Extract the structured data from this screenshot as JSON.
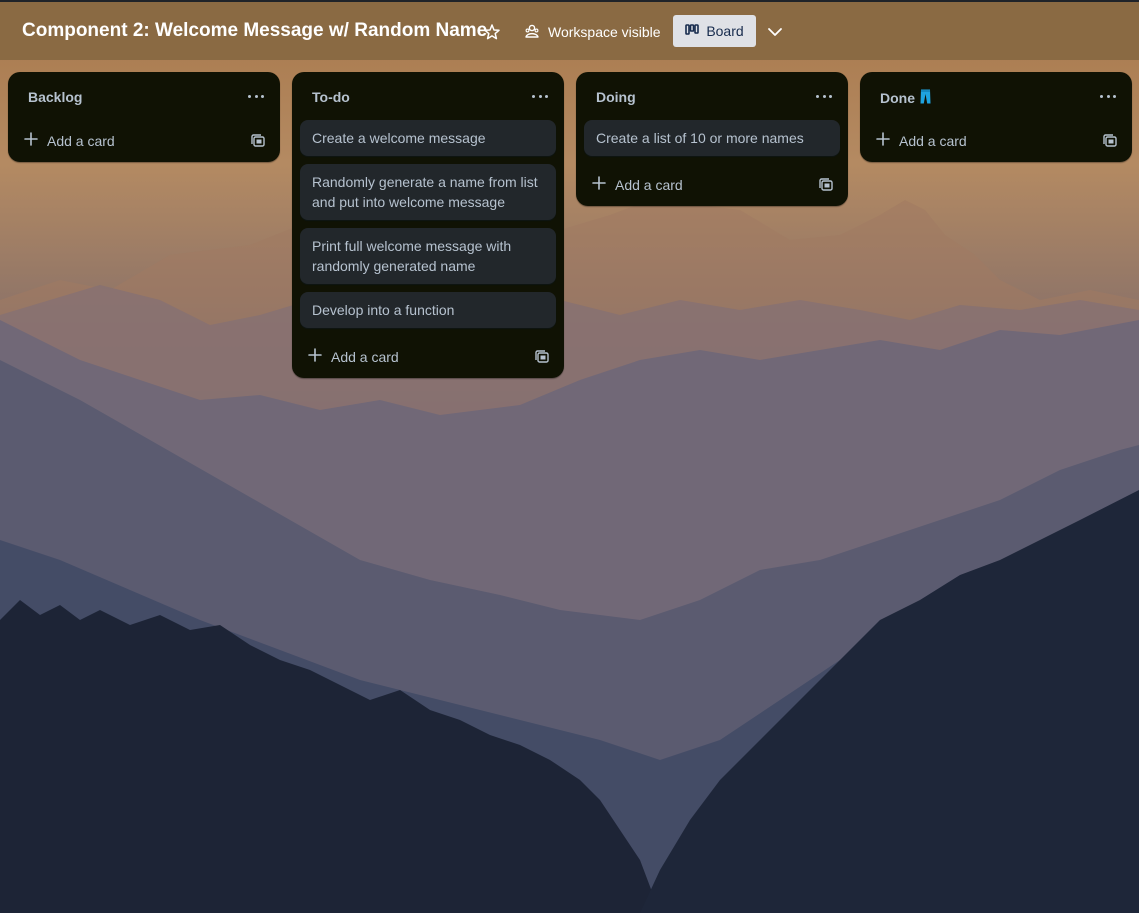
{
  "header": {
    "board_title": "Component 2: Welcome Message w/ Random Name",
    "visibility_label": "Workspace visible",
    "view_label": "Board"
  },
  "lists": [
    {
      "title": "Backlog",
      "title_icon": "",
      "cards": [],
      "add_label": "Add a card"
    },
    {
      "title": "To-do",
      "title_icon": "",
      "cards": [
        "Create a welcome message",
        "Randomly generate a name from list and put into welcome message",
        "Print full welcome message with randomly generated name",
        "Develop into a function"
      ],
      "add_label": "Add a card"
    },
    {
      "title": "Doing",
      "title_icon": "",
      "cards": [
        "Create a list of 10 or more names"
      ],
      "add_label": "Add a card"
    },
    {
      "title": "Done",
      "title_icon": "jeans-emoji",
      "cards": [],
      "add_label": "Add a card"
    }
  ],
  "icons": {
    "star": "star-icon",
    "visibility": "workspace-visible-icon",
    "view": "board-view-icon",
    "chevron": "chevron-down-icon",
    "menu": "more-horizontal-icon",
    "add": "plus-icon",
    "template": "card-template-icon"
  },
  "colors": {
    "header_bg": "#8a6a43",
    "list_bg": "#101204",
    "card_bg": "#22272b",
    "text": "#b6c2cf",
    "view_button_bg": "#dfe1e6",
    "jeans_blue": "#1ea3e0"
  }
}
